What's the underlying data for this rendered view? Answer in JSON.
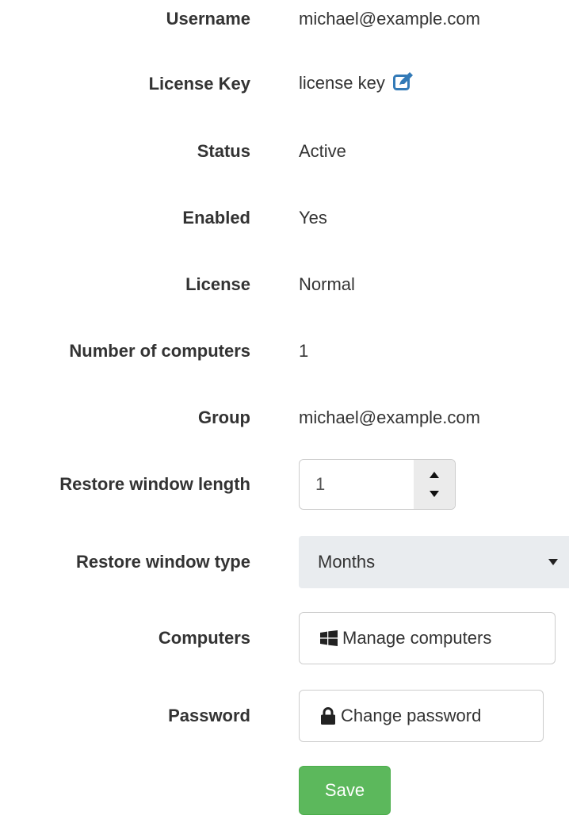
{
  "fields": {
    "username": {
      "label": "Username",
      "value": "michael@example.com"
    },
    "license_key": {
      "label": "License Key",
      "value": "license key",
      "icon": "edit-icon"
    },
    "status": {
      "label": "Status",
      "value": "Active"
    },
    "enabled": {
      "label": "Enabled",
      "value": "Yes"
    },
    "license": {
      "label": "License",
      "value": "Normal"
    },
    "num_computers": {
      "label": "Number of computers",
      "value": "1"
    },
    "group": {
      "label": "Group",
      "value": "michael@example.com"
    },
    "restore_length": {
      "label": "Restore window length",
      "value": "1"
    },
    "restore_type": {
      "label": "Restore window type",
      "value": "Months"
    },
    "computers": {
      "label": "Computers",
      "button_label": "Manage computers",
      "icon": "windows-icon"
    },
    "password": {
      "label": "Password",
      "button_label": "Change password",
      "icon": "lock-icon"
    }
  },
  "actions": {
    "save_label": "Save"
  },
  "colors": {
    "link_blue": "#337ab7",
    "save_green": "#5cb85c",
    "select_bg": "#e9ecef",
    "text": "#333333"
  }
}
